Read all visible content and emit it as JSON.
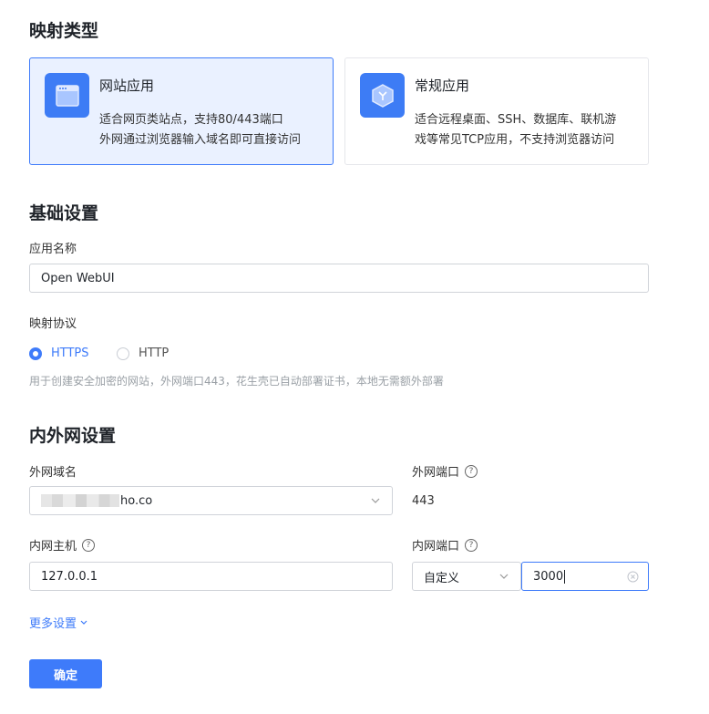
{
  "mapping_type": {
    "title": "映射类型",
    "cards": [
      {
        "title": "网站应用",
        "desc_line1": "适合网页类站点，支持80/443端口",
        "desc_line2": "外网通过浏览器输入域名即可直接访问",
        "selected": true,
        "icon": "browser-window-icon"
      },
      {
        "title": "常规应用",
        "desc_line1": "适合远程桌面、SSH、数据库、联机游",
        "desc_line2": "戏等常见TCP应用，不支持浏览器访问",
        "selected": false,
        "icon": "cube-icon"
      }
    ]
  },
  "basic": {
    "title": "基础设置",
    "app_name_label": "应用名称",
    "app_name_value": "Open WebUI",
    "protocol_label": "映射协议",
    "protocol_options": [
      "HTTPS",
      "HTTP"
    ],
    "protocol_selected": "HTTPS",
    "protocol_hint": "用于创建安全加密的网站，外网端口443，花生壳已自动部署证书，本地无需额外部署"
  },
  "network": {
    "title": "内外网设置",
    "domain_label": "外网域名",
    "domain_value_suffix": "ho.co",
    "ext_port_label": "外网端口",
    "ext_port_value": "443",
    "int_host_label": "内网主机",
    "int_host_value": "127.0.0.1",
    "int_port_label": "内网端口",
    "int_port_mode": "自定义",
    "int_port_value": "3000"
  },
  "more_settings": "更多设置",
  "confirm_label": "确定",
  "colors": {
    "primary": "#3e7bfa",
    "selected_bg": "#eaf1ff"
  }
}
